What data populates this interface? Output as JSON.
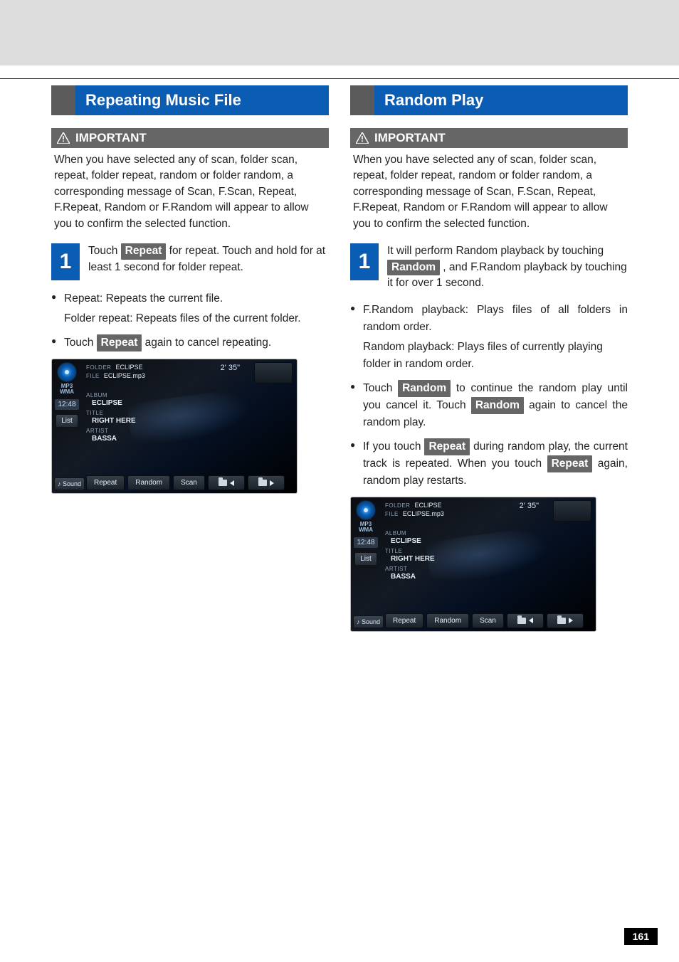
{
  "page_number": "161",
  "left": {
    "title": "Repeating Music File",
    "important_label": "IMPORTANT",
    "important_body": "When you have selected any of scan, folder scan, repeat, folder repeat, random or folder random, a corresponding message of Scan, F.Scan, Repeat, F.Repeat, Random or F.Random will appear to allow you to confirm the selected function.",
    "step_num": "1",
    "step_pre": "Touch ",
    "step_chip": "Repeat",
    "step_post": " for repeat. Touch and hold for at least 1 second for folder repeat.",
    "b1_line1": "Repeat: Repeats the current file.",
    "b1_line2": "Folder repeat: Repeats files of the current folder.",
    "b2_pre": "Touch ",
    "b2_chip": "Repeat",
    "b2_post": " again to cancel repeating."
  },
  "right": {
    "title": "Random Play",
    "important_label": "IMPORTANT",
    "important_body": "When you have selected any of scan, folder scan, repeat, folder repeat, random or folder random, a corresponding message of Scan, F.Scan, Repeat, F.Repeat, Random or F.Random will appear to allow you to confirm the selected function.",
    "step_num": "1",
    "step_pre": "It will perform Random playback by touching ",
    "step_chip": "Random",
    "step_post": " , and F.Random playback by touching it for over 1 second.",
    "b1_line1": "F.Random playback: Plays files of all folders in random order.",
    "b1_line2": "Random playback: Plays files of currently playing folder in random order.",
    "b2_pre": "Touch ",
    "b2_chip1": "Random",
    "b2_mid": " to continue the random play until you cancel it. Touch ",
    "b2_chip2": "Random",
    "b2_post": " again to cancel the random play.",
    "b3_pre": "If you touch ",
    "b3_chip1": "Repeat",
    "b3_mid": " during random play, the current track is repeated. When you touch ",
    "b3_chip2": "Repeat",
    "b3_post": " again, random play restarts."
  },
  "player": {
    "fmt1": "MP3",
    "fmt2": "WMA",
    "clock": "12:48",
    "list": "List",
    "sound": "♪ Sound",
    "folder_lbl": "FOLDER",
    "folder_val": "ECLIPSE",
    "file_lbl": "FILE",
    "file_val": "ECLIPSE.mp3",
    "duration": "2' 35\"",
    "album_lbl": "ALBUM",
    "album_val": "ECLIPSE",
    "title_lbl": "TITLE",
    "title_val": "RIGHT HERE",
    "artist_lbl": "ARTIST",
    "artist_val": "BASSA",
    "btn_repeat": "Repeat",
    "btn_random": "Random",
    "btn_scan": "Scan"
  }
}
